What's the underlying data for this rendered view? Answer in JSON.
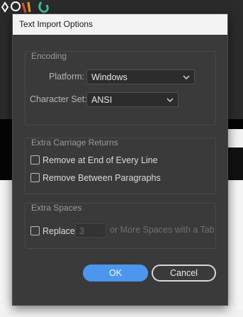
{
  "dialog": {
    "title": "Text Import Options"
  },
  "encoding": {
    "legend": "Encoding",
    "platform_label": "Platform:",
    "platform_value": "Windows",
    "charset_label": "Character Set:",
    "charset_value": "ANSI"
  },
  "carriage_returns": {
    "legend": "Extra Carriage Returns",
    "remove_end_of_line_label": "Remove at End of Every Line",
    "remove_end_of_line_checked": false,
    "remove_between_paragraphs_label": "Remove Between Paragraphs",
    "remove_between_paragraphs_checked": false
  },
  "extra_spaces": {
    "legend": "Extra Spaces",
    "replace_label": "Replace",
    "replace_checked": false,
    "count_value": "3",
    "suffix_text": "or More Spaces with a Tab"
  },
  "buttons": {
    "ok_label": "OK",
    "cancel_label": "Cancel"
  },
  "colors": {
    "accent": "#4d96ee",
    "dialog_bg": "#3a3a3a",
    "titlebar_bg": "#f3f3f3"
  }
}
